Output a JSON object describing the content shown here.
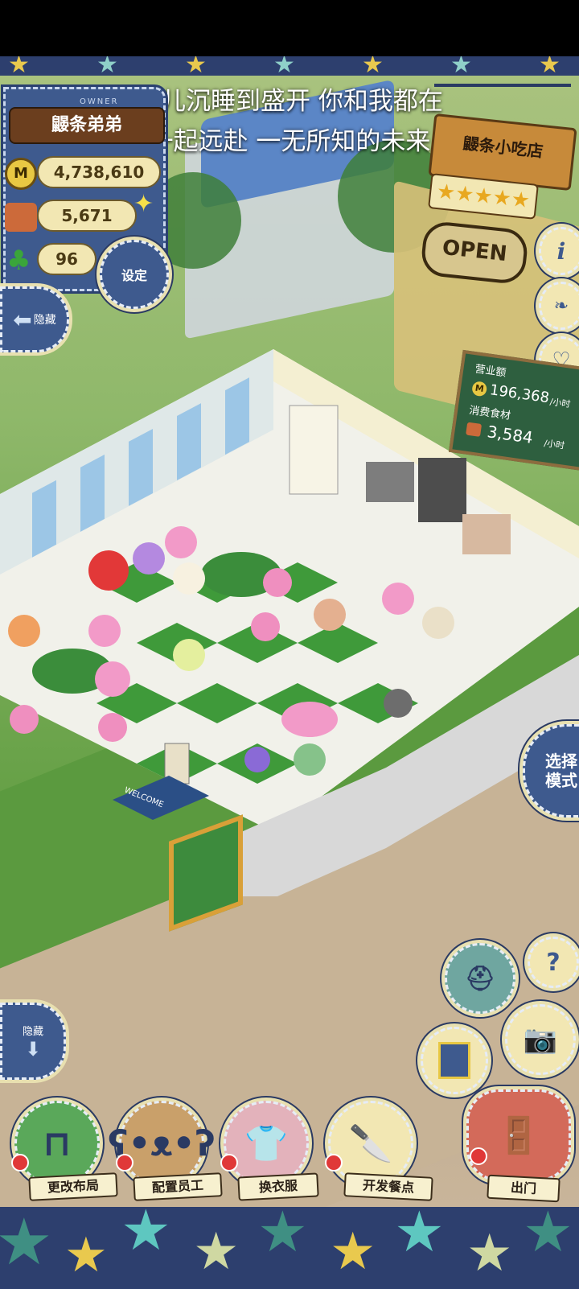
{
  "lyrics": {
    "line1": "花儿沉睡到盛开 你和我都在",
    "line2": "一起远赴 一无所知的未来"
  },
  "owner_panel": {
    "header": "OWNER",
    "name": "鼹条弟弟",
    "money": "4,738,610",
    "food": "5,671",
    "clover": "96",
    "settings_label": "设定",
    "money_icon": "M"
  },
  "hide_top": "隐藏",
  "shop_sign": {
    "name": "鼹条小吃店",
    "stars": "★★★★★",
    "open_label": "OPEN"
  },
  "side_buttons": [
    "info-icon",
    "book-icon",
    "heart-icon"
  ],
  "revenue_board": {
    "revenue_label": "营业额",
    "revenue_value": "196,368",
    "revenue_unit": "/小时",
    "food_label": "消费食材",
    "food_value": "3,584",
    "food_unit": "/小时",
    "coin_icon": "M"
  },
  "select_mode": "选择\n模式",
  "welcome_mat": "WELCOME",
  "hide_bottom": "隐藏",
  "right_controls": {
    "help": "?"
  },
  "bottom_menu": [
    {
      "label": "更改布局",
      "icon": "table-icon"
    },
    {
      "label": "配置员工",
      "icon": "bear-icon"
    },
    {
      "label": "换衣服",
      "icon": "shirt-icon"
    },
    {
      "label": "开发餐点",
      "icon": "knife-icon"
    },
    {
      "label": "出门",
      "icon": "door-icon"
    }
  ],
  "colors": {
    "denim": "#3e5a8e",
    "grass": "#6aa34a",
    "tile_green": "#3f9a3a",
    "board": "#2e5f3f",
    "sign_wood": "#c78a3a"
  }
}
